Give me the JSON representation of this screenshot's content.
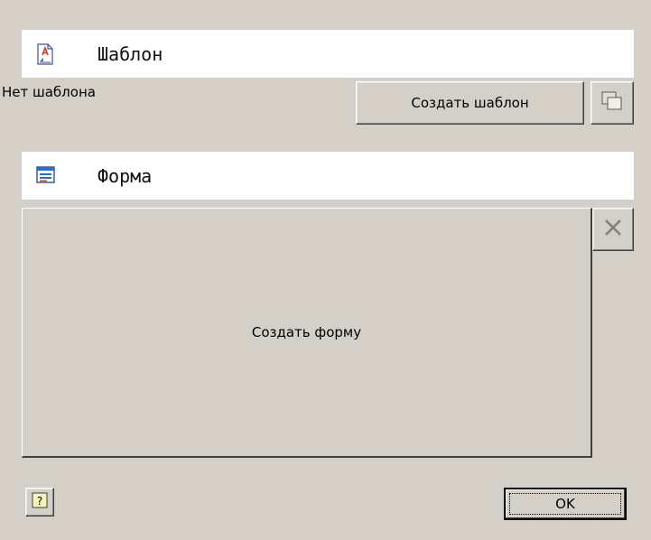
{
  "template_section": {
    "title": "Шаблон",
    "icon": "template-document-icon",
    "status_text": "Нет шаблона",
    "create_button_label": "Создать шаблон",
    "copy_button_icon": "copy-icon"
  },
  "form_section": {
    "title": "Форма",
    "icon": "form-window-icon",
    "create_form_label": "Создать форму",
    "delete_button_icon": "close-icon"
  },
  "footer": {
    "help_button_icon": "help-icon",
    "ok_label": "OK"
  },
  "colors": {
    "dialog_bg": "#d4d0c8",
    "header_bg": "#ffffff"
  }
}
